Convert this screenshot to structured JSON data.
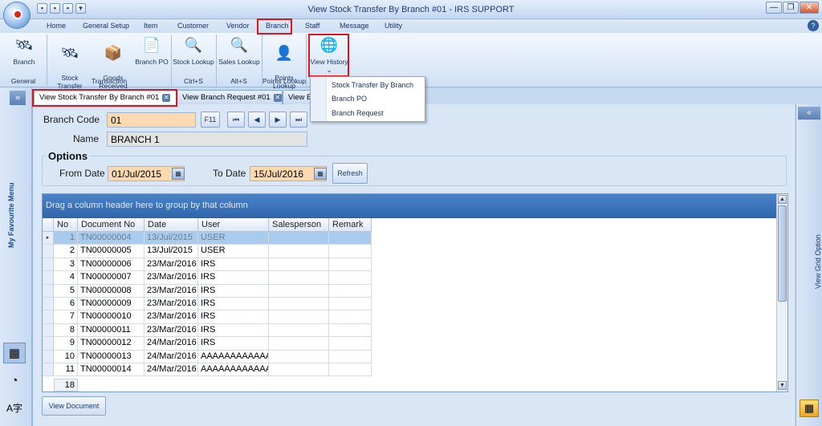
{
  "window": {
    "title": "View Stock Transfer By Branch #01 - IRS SUPPORT",
    "min": "—",
    "max": "❐",
    "close": "✕"
  },
  "qat_icons": [
    "save-icon",
    "lock-icon",
    "clock-icon",
    "dropdown-icon"
  ],
  "menu": [
    "Home",
    "General Setup",
    "Item",
    "Customer",
    "Vendor",
    "Branch",
    "Staff",
    "Message",
    "Utility"
  ],
  "menu_active": "Branch",
  "ribbon": {
    "buttons": [
      {
        "label": "Branch",
        "icon": "satellite-icon",
        "glyph": "🛰"
      },
      {
        "label": "Stock\nTransfer",
        "icon": "satellite-transfer-icon",
        "glyph": "🛰"
      },
      {
        "label": "Goods\nReceived",
        "icon": "box-icon",
        "glyph": "📦"
      },
      {
        "label": "Branch PO",
        "icon": "document-icon",
        "glyph": "📄"
      },
      {
        "label": "Stock Lookup",
        "icon": "magnifier-icon",
        "glyph": "🔍"
      },
      {
        "label": "Sales Lookup",
        "icon": "magnifier-icon",
        "glyph": "🔍"
      },
      {
        "label": "Points\nLookup",
        "icon": "person-icon",
        "glyph": "👤"
      },
      {
        "label": "View History",
        "icon": "globe-icon",
        "glyph": "🌐"
      }
    ],
    "groups": [
      "General",
      "Transaction",
      "Ctrl+S",
      "Alt+S",
      "Points Lookup"
    ]
  },
  "dropdown": {
    "items": [
      "Stock Transfer By Branch",
      "Branch PO",
      "Branch Request"
    ],
    "arrow": "⌄"
  },
  "leftbar": {
    "fav_menu": "My Favourite Menu",
    "arrow": "»"
  },
  "tabs": [
    "View Stock Transfer By Branch #01",
    "View Branch Request #01",
    "View B"
  ],
  "form": {
    "branch_code_label": "Branch Code",
    "branch_code": "01",
    "f11": "F11",
    "nav": [
      "⏮",
      "◀",
      "▶",
      "⏭"
    ],
    "name_label": "Name",
    "name": "BRANCH 1",
    "options_title": "Options",
    "from_label": "From Date",
    "from_date": "01/Jul/2015",
    "to_label": "To Date",
    "to_date": "15/Jul/2016",
    "refresh": "Refresh"
  },
  "grid": {
    "group_hint": "Drag a column header here to group by that column",
    "columns": [
      "No",
      "Document No",
      "Date",
      "User",
      "Salesperson",
      "Remark"
    ],
    "rows": [
      [
        "1",
        "TN00000004",
        "13/Jul/2015",
        "USER",
        "",
        ""
      ],
      [
        "2",
        "TN00000005",
        "13/Jul/2015",
        "USER",
        "",
        ""
      ],
      [
        "3",
        "TN00000006",
        "23/Mar/2016",
        "IRS",
        "",
        ""
      ],
      [
        "4",
        "TN00000007",
        "23/Mar/2016",
        "IRS",
        "",
        ""
      ],
      [
        "5",
        "TN00000008",
        "23/Mar/2016",
        "IRS",
        "",
        ""
      ],
      [
        "6",
        "TN00000009",
        "23/Mar/2016",
        "IRS",
        "",
        ""
      ],
      [
        "7",
        "TN00000010",
        "23/Mar/2016",
        "IRS",
        "",
        ""
      ],
      [
        "8",
        "TN00000011",
        "23/Mar/2016",
        "IRS",
        "",
        ""
      ],
      [
        "9",
        "TN00000012",
        "24/Mar/2016",
        "IRS",
        "",
        ""
      ],
      [
        "10",
        "TN00000013",
        "24/Mar/2016",
        "AAAAAAAAAAAA",
        "",
        ""
      ],
      [
        "11",
        "TN00000014",
        "24/Mar/2016",
        "AAAAAAAAAAAA",
        "",
        ""
      ]
    ],
    "footer_count": "18",
    "selected_row": 0
  },
  "view_document": "View Document",
  "rightpanel": {
    "collapse": "«",
    "label": "View Grid Option"
  }
}
